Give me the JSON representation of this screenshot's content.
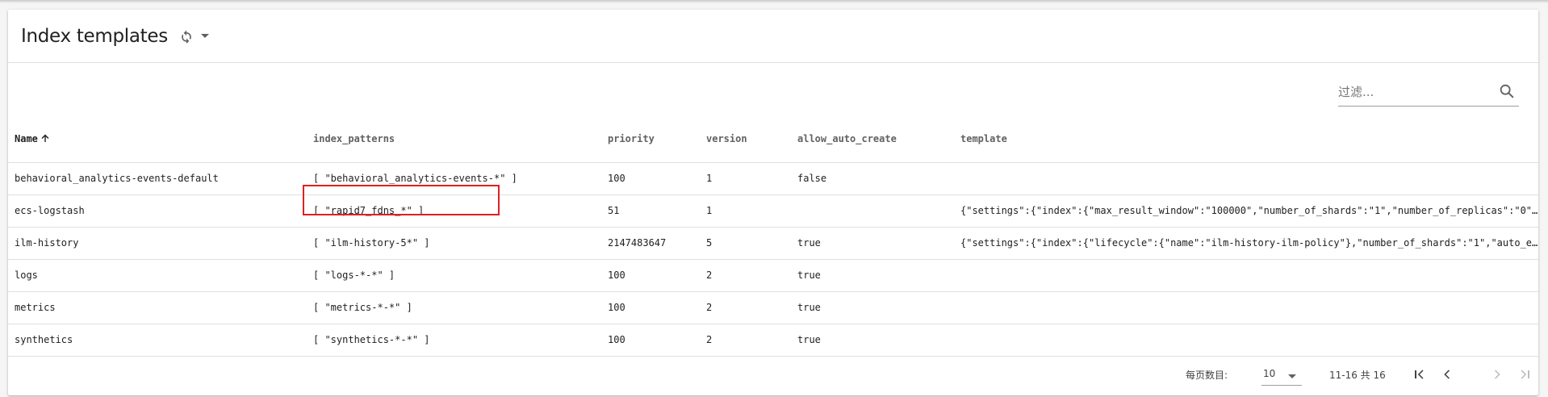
{
  "header": {
    "title": "Index templates",
    "refresh_icon": "refresh-icon",
    "menu_icon": "caret-down-icon"
  },
  "filter": {
    "placeholder": "过滤...",
    "value": "",
    "icon": "search-icon"
  },
  "table": {
    "columns": [
      {
        "label": "Name",
        "sorted": "asc"
      },
      {
        "label": "index_patterns"
      },
      {
        "label": "priority"
      },
      {
        "label": "version"
      },
      {
        "label": "allow_auto_create"
      },
      {
        "label": "template"
      }
    ],
    "rows": [
      {
        "name": "behavioral_analytics-events-default",
        "index_patterns": "[ \"behavioral_analytics-events-*\" ]",
        "priority": "100",
        "version": "1",
        "allow_auto_create": "false",
        "template": ""
      },
      {
        "name": "ecs-logstash",
        "index_patterns": "[ \"rapid7_fdns_*\" ]",
        "priority": "51",
        "version": "1",
        "allow_auto_create": "",
        "template": "{\"settings\":{\"index\":{\"max_result_window\":\"100000\",\"number_of_shards\":\"1\",\"number_of_replicas\":\"0\"}},\"mapping..."
      },
      {
        "name": "ilm-history",
        "index_patterns": "[ \"ilm-history-5*\" ]",
        "priority": "2147483647",
        "version": "5",
        "allow_auto_create": "true",
        "template": "{\"settings\":{\"index\":{\"lifecycle\":{\"name\":\"ilm-history-ilm-policy\"},\"number_of_shards\":\"1\",\"auto_expand_repli..."
      },
      {
        "name": "logs",
        "index_patterns": "[ \"logs-*-*\" ]",
        "priority": "100",
        "version": "2",
        "allow_auto_create": "true",
        "template": ""
      },
      {
        "name": "metrics",
        "index_patterns": "[ \"metrics-*-*\" ]",
        "priority": "100",
        "version": "2",
        "allow_auto_create": "true",
        "template": ""
      },
      {
        "name": "synthetics",
        "index_patterns": "[ \"synthetics-*-*\" ]",
        "priority": "100",
        "version": "2",
        "allow_auto_create": "true",
        "template": ""
      }
    ],
    "highlighted_row": "ecs-logstash"
  },
  "paginator": {
    "page_size_label": "每页数目:",
    "page_size": "10",
    "range_label": "11-16 共 16",
    "first_icon": "first-page-icon",
    "prev_icon": "chevron-left-icon",
    "next_icon": "chevron-right-icon",
    "last_icon": "last-page-icon"
  },
  "colors": {
    "highlight": "#e02020",
    "disabled": "#bdbdbd"
  }
}
